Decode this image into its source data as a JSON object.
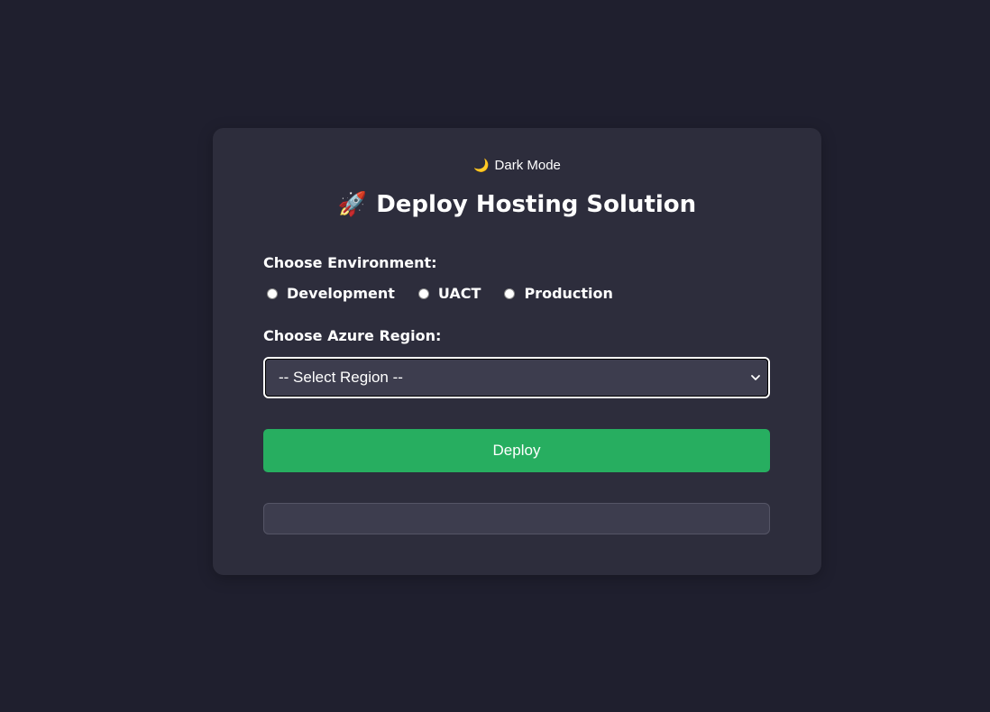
{
  "dark_mode_toggle": {
    "icon": "crescent-moon-icon",
    "glyph": "🌙",
    "label": "Dark Mode"
  },
  "header": {
    "icon": "rocket-icon",
    "glyph": "🚀",
    "title": "Deploy Hosting Solution"
  },
  "environment": {
    "label": "Choose Environment:",
    "options": [
      {
        "label": "Development",
        "selected": false
      },
      {
        "label": "UACT",
        "selected": false
      },
      {
        "label": "Production",
        "selected": false
      }
    ]
  },
  "region": {
    "label": "Choose Azure Region:",
    "selected": "-- Select Region --"
  },
  "deploy_button": {
    "label": "Deploy"
  },
  "output": {
    "text": ""
  },
  "colors": {
    "page_background": "#1f1f2e",
    "card_background": "#2d2d3c",
    "input_background": "#3d3d4e",
    "accent_green": "#27ae60",
    "text": "#ffffff"
  }
}
